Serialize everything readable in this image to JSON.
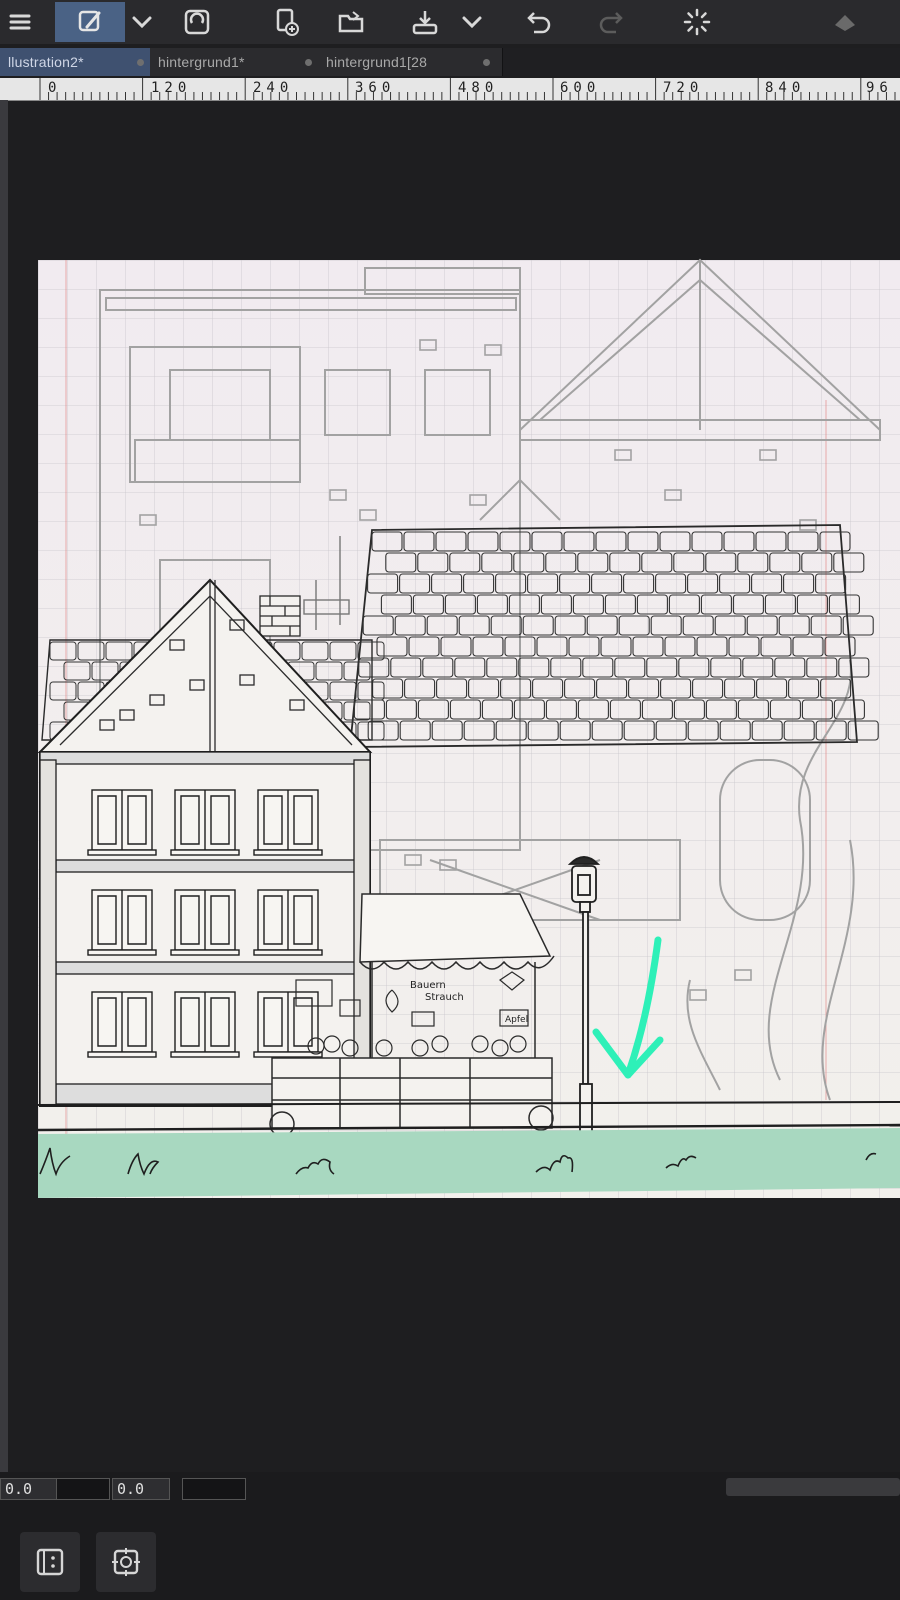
{
  "toolbar": {
    "icons": [
      "menu-icon",
      "brush-tool-icon",
      "chevron-down-icon",
      "transform-icon",
      "new-layer-icon",
      "open-folder-icon",
      "save-icon",
      "chevron-down-icon",
      "undo-icon",
      "redo-icon",
      "loading-icon",
      "settings-icon"
    ]
  },
  "tabs": [
    {
      "label": "llustration2*",
      "active": true
    },
    {
      "label": "hintergrund1*",
      "active": false
    },
    {
      "label": "hintergrund1[28",
      "active": false
    }
  ],
  "ruler": {
    "labels": [
      "0",
      "120",
      "240",
      "360",
      "480",
      "600",
      "720",
      "840",
      "96"
    ]
  },
  "canvas": {
    "shop_sign_lines": [
      "Bauern",
      "Strauch"
    ],
    "shop_price_tag": "Apfel"
  },
  "bottom": {
    "field1_value": "0.0",
    "field2_value": "0.0"
  },
  "colors": {
    "accent": "#4a6285",
    "grass": "#a8d8c0",
    "arrow": "#2ef0b8"
  }
}
